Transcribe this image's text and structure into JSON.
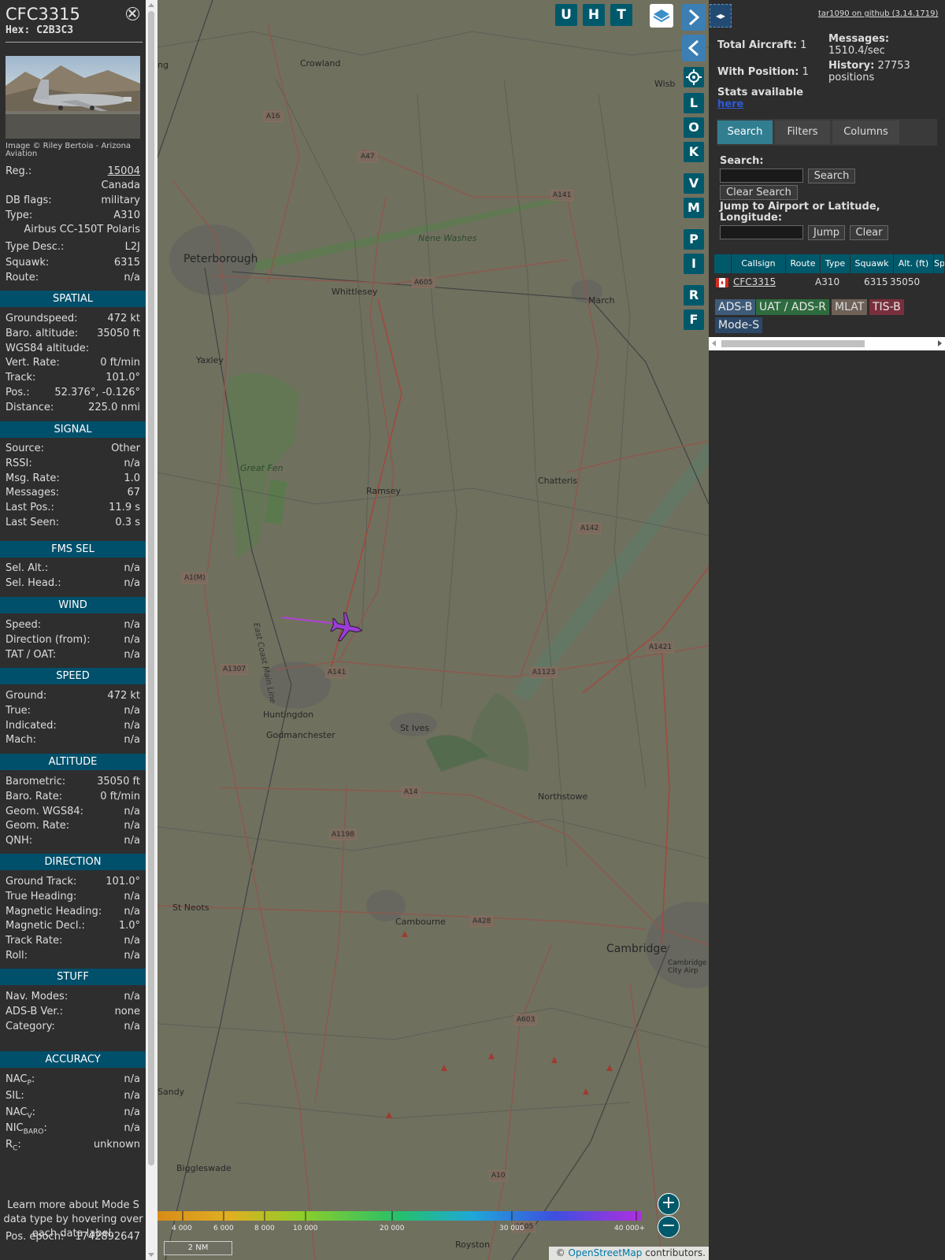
{
  "aircraft": {
    "callsign": "CFC3315",
    "hex_label": "Hex:",
    "hex": "C2B3C3",
    "photo_credit": "Image © Riley Bertoia - Arizona Aviation"
  },
  "details": [
    {
      "k": "Reg.:",
      "v": "15004",
      "link": true
    },
    {
      "k": "",
      "v": "Canada"
    },
    {
      "k": "DB flags:",
      "v": "military"
    },
    {
      "k": "Type:",
      "v": "A310"
    },
    {
      "k": "",
      "v": "Airbus CC-150T Polaris"
    },
    {
      "k": "Type Desc.:",
      "v": "L2J"
    },
    {
      "k": "Squawk:",
      "v": "6315"
    },
    {
      "k": "Route:",
      "v": "n/a"
    }
  ],
  "sections": {
    "spatial": {
      "title": "SPATIAL",
      "rows": [
        {
          "k": "Groundspeed:",
          "v": "472 kt"
        },
        {
          "k": "Baro. altitude:",
          "v": "35050 ft"
        },
        {
          "k": "WGS84 altitude:",
          "v": ""
        },
        {
          "k": "Vert. Rate:",
          "v": "0 ft/min"
        },
        {
          "k": "Track:",
          "v": "101.0°"
        },
        {
          "k": "Pos.:",
          "v": "52.376°, -0.126°"
        },
        {
          "k": "Distance:",
          "v": "225.0 nmi"
        }
      ]
    },
    "signal": {
      "title": "SIGNAL",
      "rows": [
        {
          "k": "Source:",
          "v": "Other"
        },
        {
          "k": "RSSI:",
          "v": "n/a"
        },
        {
          "k": "Msg. Rate:",
          "v": "1.0"
        },
        {
          "k": "Messages:",
          "v": "67"
        },
        {
          "k": "Last Pos.:",
          "v": "11.9 s"
        },
        {
          "k": "Last Seen:",
          "v": "0.3 s"
        }
      ]
    },
    "fms": {
      "title": "FMS SEL",
      "rows": [
        {
          "k": "Sel. Alt.:",
          "v": "n/a"
        },
        {
          "k": "Sel. Head.:",
          "v": "n/a"
        }
      ]
    },
    "wind": {
      "title": "WIND",
      "rows": [
        {
          "k": "Speed:",
          "v": "n/a"
        },
        {
          "k": "Direction (from):",
          "v": "n/a"
        },
        {
          "k": "TAT / OAT:",
          "v": "n/a"
        }
      ]
    },
    "speed": {
      "title": "SPEED",
      "rows": [
        {
          "k": "Ground:",
          "v": "472 kt"
        },
        {
          "k": "True:",
          "v": "n/a"
        },
        {
          "k": "Indicated:",
          "v": "n/a"
        },
        {
          "k": "Mach:",
          "v": "n/a"
        }
      ]
    },
    "altitude": {
      "title": "ALTITUDE",
      "rows": [
        {
          "k": "Barometric:",
          "v": "35050 ft"
        },
        {
          "k": "Baro. Rate:",
          "v": "0 ft/min"
        },
        {
          "k": "Geom. WGS84:",
          "v": "n/a"
        },
        {
          "k": "Geom. Rate:",
          "v": "n/a"
        },
        {
          "k": "QNH:",
          "v": "n/a"
        }
      ]
    },
    "direction": {
      "title": "DIRECTION",
      "rows": [
        {
          "k": "Ground Track:",
          "v": "101.0°"
        },
        {
          "k": "True Heading:",
          "v": "n/a"
        },
        {
          "k": "Magnetic Heading:",
          "v": "n/a"
        },
        {
          "k": "Magnetic Decl.:",
          "v": "1.0°"
        },
        {
          "k": "Track Rate:",
          "v": "n/a"
        },
        {
          "k": "Roll:",
          "v": "n/a"
        }
      ]
    },
    "stuff": {
      "title": "STUFF",
      "rows": [
        {
          "k": "Nav. Modes:",
          "v": "n/a"
        },
        {
          "k": "ADS-B Ver.:",
          "v": "none"
        },
        {
          "k": "Category:",
          "v": "n/a"
        }
      ]
    },
    "accuracy": {
      "title": "ACCURACY",
      "rows": [
        {
          "k": "NAC",
          "sub": "P",
          "v": "n/a"
        },
        {
          "k": "SIL:",
          "v": "n/a"
        },
        {
          "k": "NAC",
          "sub": "V",
          "v": "n/a"
        },
        {
          "k": "NIC",
          "sub": "BARO",
          "v": "n/a"
        },
        {
          "k": "R",
          "sub": "C",
          "v": "unknown"
        }
      ]
    }
  },
  "learn_more": "Learn more about Mode S data type by hovering over each data label.",
  "pos_epoch": {
    "k": "Pos. epoch:",
    "v": "1742892647"
  },
  "map": {
    "buttons_top": [
      "U",
      "H",
      "T"
    ],
    "buttons_side": [
      "L",
      "O",
      "K",
      "V",
      "M",
      "P",
      "I",
      "R",
      "F"
    ],
    "places": [
      {
        "name": "Crowland"
      },
      {
        "name": "Peterborough"
      },
      {
        "name": "Whittlesey"
      },
      {
        "name": "March"
      },
      {
        "name": "Yaxley"
      },
      {
        "name": "Nene Washes"
      },
      {
        "name": "Great Fen"
      },
      {
        "name": "Ramsey"
      },
      {
        "name": "Chatteris"
      },
      {
        "name": "Huntingdon"
      },
      {
        "name": "Godmanchester"
      },
      {
        "name": "St Ives"
      },
      {
        "name": "Northstowe"
      },
      {
        "name": "St Neots"
      },
      {
        "name": "Cambourne"
      },
      {
        "name": "Cambridge"
      },
      {
        "name": "Biggleswade"
      },
      {
        "name": "Royston"
      },
      {
        "name": "Sandy"
      },
      {
        "name": "East Coast Main Line"
      },
      {
        "name": "Wisb"
      },
      {
        "name": "Cambridge City Airp"
      },
      {
        "name": "ng"
      }
    ],
    "roads": [
      "A16",
      "A47",
      "A141",
      "A605",
      "A142",
      "A1(M)",
      "A1307",
      "A141",
      "A1123",
      "A1421",
      "A14",
      "A1198",
      "A428",
      "A603",
      "A10",
      "A505"
    ],
    "colorbar_labels": [
      "4 000",
      "6 000",
      "8 000",
      "10 000",
      "20 000",
      "30 000",
      "40 000+"
    ],
    "scale": "2 NM",
    "attribution_prefix": "© ",
    "attribution_link": "OpenStreetMap",
    "attribution_suffix": " contributors."
  },
  "right": {
    "github": "tar1090 on github (3.14.1719)",
    "total_aircraft_label": "Total Aircraft:",
    "total_aircraft": "1",
    "with_position_label": "With Position:",
    "with_position": "1",
    "messages_label": "Messages:",
    "messages": "1510.4/sec",
    "history_label": "History:",
    "history": "27753",
    "history_unit": "positions",
    "stats_label": "Stats available",
    "stats_link": "here",
    "tabs": [
      "Search",
      "Filters",
      "Columns"
    ],
    "search_label": "Search:",
    "search_btn": "Search",
    "clear_search_btn": "Clear Search",
    "jump_label": "Jump to Airport or Latitude, Longitude:",
    "jump_btn": "Jump",
    "clear_btn": "Clear",
    "columns": [
      "Callsign",
      "Route",
      "Type",
      "Squawk",
      "Alt. (ft)",
      "Spd"
    ],
    "row": {
      "callsign": "CFC3315",
      "route": "",
      "type": "A310",
      "squawk": "6315",
      "alt": "35050"
    },
    "legend": [
      {
        "label": "ADS-B",
        "color": "#3f5b7a"
      },
      {
        "label": "UAT / ADS-R",
        "color": "#2e6b3e"
      },
      {
        "label": "MLAT",
        "color": "#6e6158"
      },
      {
        "label": "TIS-B",
        "color": "#7a2f3d"
      },
      {
        "label": "Mode-S",
        "color": "#2c4869"
      }
    ]
  }
}
